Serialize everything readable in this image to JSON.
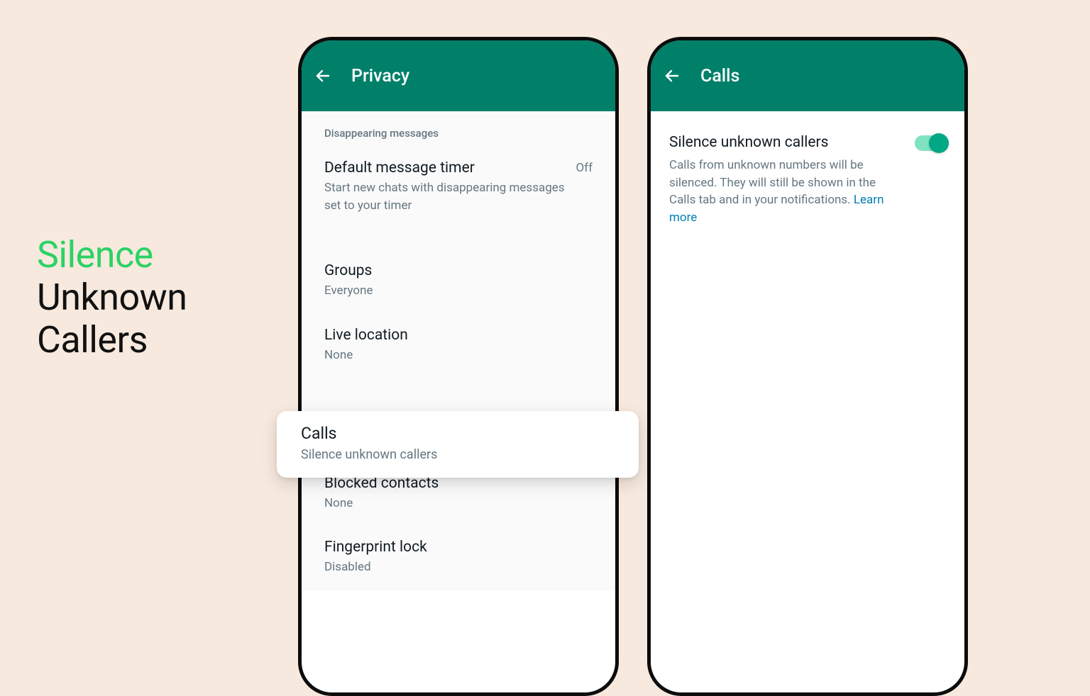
{
  "headline": {
    "line1": "Silence",
    "line2": "Unknown",
    "line3": "Callers"
  },
  "privacy_screen": {
    "title": "Privacy",
    "section_header": "Disappearing messages",
    "default_timer": {
      "title": "Default message timer",
      "subtitle": "Start new chats with disappearing messages set to your timer",
      "value": "Off"
    },
    "groups": {
      "title": "Groups",
      "subtitle": "Everyone"
    },
    "live_location": {
      "title": "Live location",
      "subtitle": "None"
    },
    "calls": {
      "title": "Calls",
      "subtitle": "Silence unknown callers"
    },
    "blocked_contacts": {
      "title": "Blocked contacts",
      "subtitle": "None"
    },
    "fingerprint_lock": {
      "title": "Fingerprint lock",
      "subtitle": "Disabled"
    }
  },
  "calls_screen": {
    "title": "Calls",
    "silence_setting": {
      "title": "Silence unknown callers",
      "description": "Calls from unknown numbers will be silenced. They will still be shown in the Calls tab and in your notifications. ",
      "learn_more": "Learn more",
      "enabled": true
    }
  }
}
